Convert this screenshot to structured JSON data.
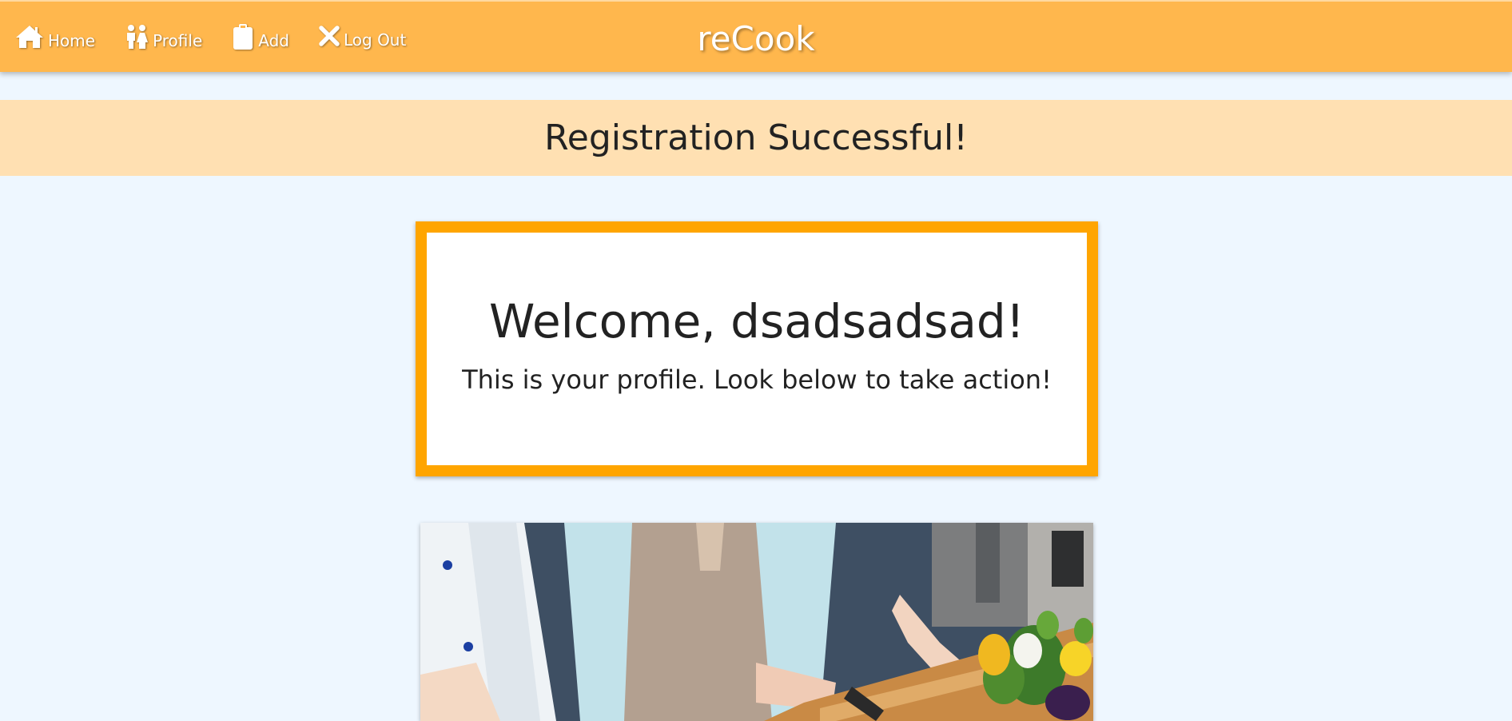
{
  "nav": {
    "brand": "reCook",
    "links": [
      {
        "label": "Home",
        "icon": "home-icon"
      },
      {
        "label": "Profile",
        "icon": "people-icon"
      },
      {
        "label": "Add",
        "icon": "clipboard-icon"
      },
      {
        "label": "Log Out",
        "icon": "close-icon"
      }
    ]
  },
  "alert": {
    "message": "Registration Successful!"
  },
  "welcome": {
    "heading": "Welcome, dsadsadsad!",
    "subtext": "This is your profile. Look below to take action!"
  },
  "colors": {
    "navbar": "#ffb74d",
    "alert_bg": "#ffe0b2",
    "card_border": "#ffa500",
    "page_bg": "#eef7ff"
  }
}
